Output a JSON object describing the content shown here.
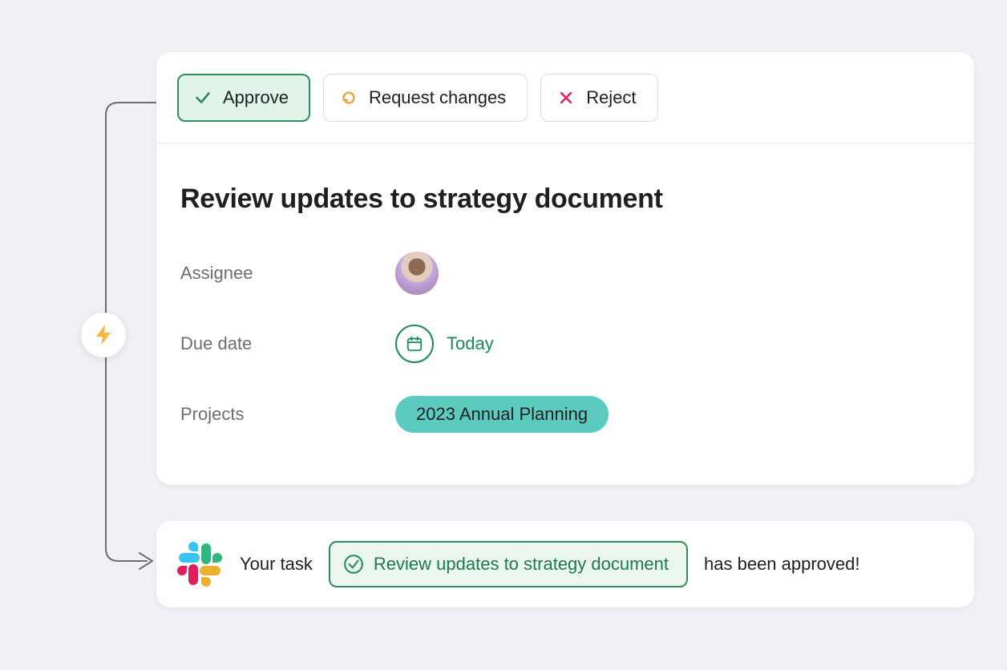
{
  "actions": {
    "approve": "Approve",
    "request": "Request changes",
    "reject": "Reject"
  },
  "task": {
    "title": "Review updates to strategy document"
  },
  "fields": {
    "assignee_label": "Assignee",
    "due_label": "Due date",
    "due_value": "Today",
    "projects_label": "Projects",
    "project_name": "2023 Annual Planning"
  },
  "notification": {
    "prefix": "Your task",
    "chip": "Review updates to strategy document",
    "suffix": "has been approved!"
  }
}
